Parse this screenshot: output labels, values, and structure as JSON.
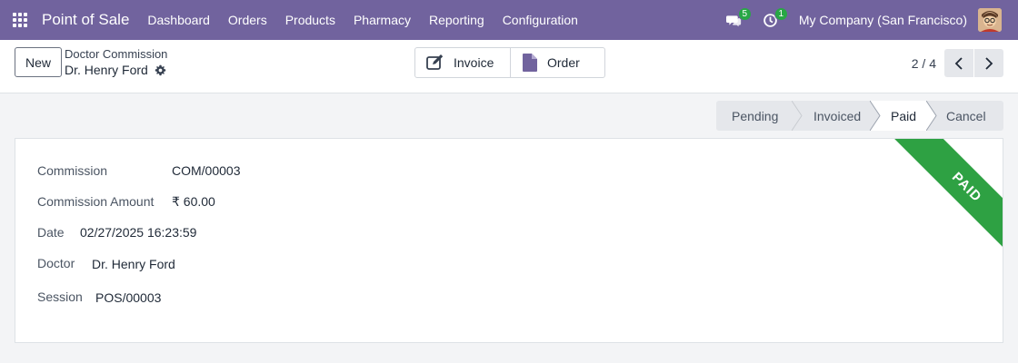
{
  "navbar": {
    "brand": "Point of Sale",
    "menu": [
      "Dashboard",
      "Orders",
      "Products",
      "Pharmacy",
      "Reporting",
      "Configuration"
    ],
    "messages_count": "5",
    "activities_count": "1",
    "company": "My Company (San Francisco)",
    "icons": [
      "apps-grid-icon",
      "chat-icon",
      "clock-icon"
    ],
    "accent_color": "#71639e",
    "badge_color": "#28a745"
  },
  "control_panel": {
    "new_label": "New",
    "breadcrumb_parent": "Doctor Commission",
    "breadcrumb_current": "Dr. Henry Ford",
    "smart_buttons": {
      "invoice": "Invoice",
      "order": "Order"
    },
    "pager": "2 / 4"
  },
  "status_bar": {
    "stages": [
      "Pending",
      "Invoiced",
      "Paid",
      "Cancel"
    ],
    "current": "Paid"
  },
  "form": {
    "commission_label": "Commission",
    "commission_value": "COM/00003",
    "amount_label": "Commission Amount",
    "amount_value": "₹ 60.00",
    "date_label": "Date",
    "date_value": "02/27/2025 16:23:59",
    "doctor_label": "Doctor",
    "doctor_value": "Dr. Henry Ford",
    "session_label": "Session",
    "session_value": "POS/00003",
    "ribbon": "PAID",
    "ribbon_color": "#2ea143"
  }
}
